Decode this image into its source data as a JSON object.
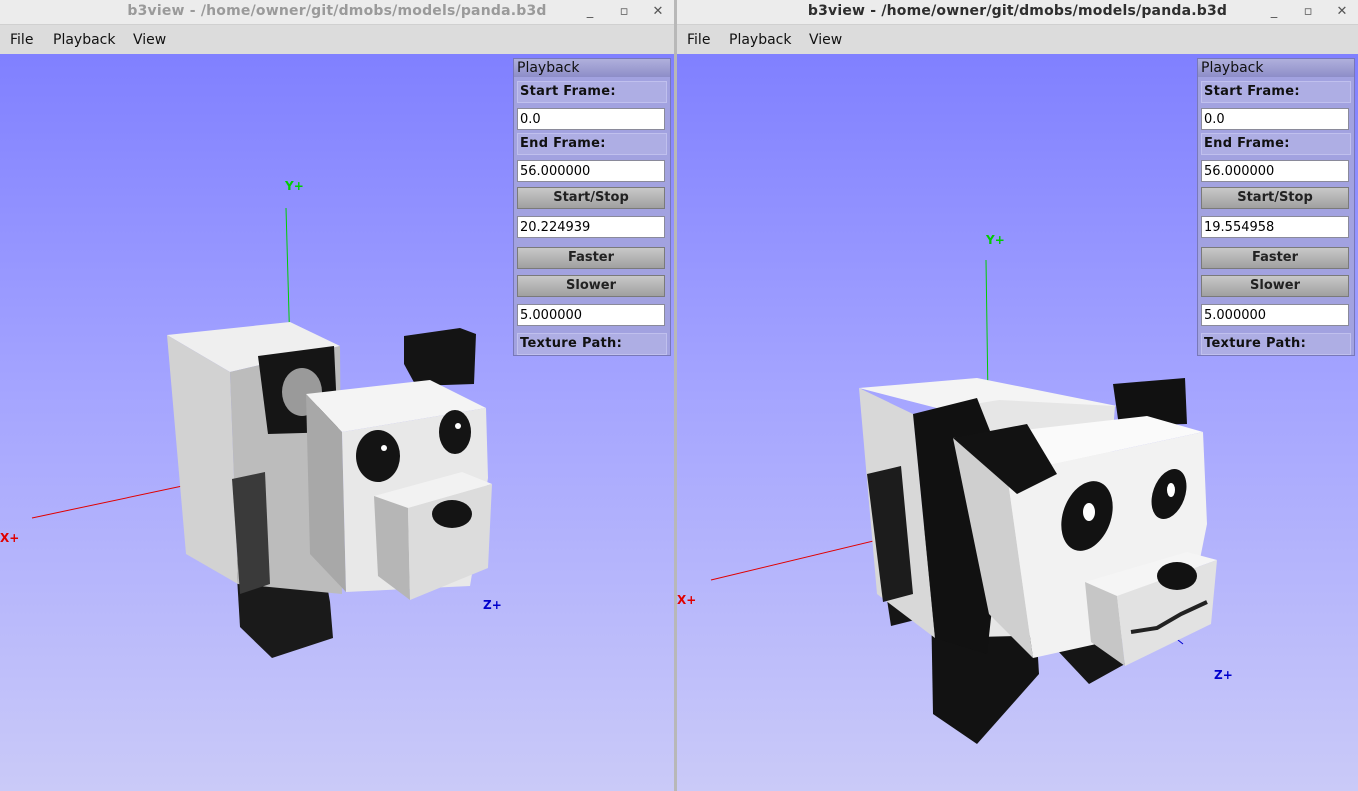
{
  "windows": [
    {
      "title": "b3view - /home/owner/git/dmobs/models/panda.b3d",
      "controls": {
        "minimize": "_",
        "maximize": "▫",
        "close": "✕"
      },
      "menu": [
        "File",
        "Playback",
        "View"
      ],
      "panel": {
        "title": "Playback",
        "start_frame_label": "Start Frame:",
        "start_frame_value": "0.0",
        "end_frame_label": "End Frame:",
        "end_frame_value": "56.000000",
        "start_stop_label": "Start/Stop",
        "current_frame_value": "20.224939",
        "faster_label": "Faster",
        "slower_label": "Slower",
        "speed_value": "5.000000",
        "texture_path_label": "Texture Path:"
      },
      "axes": {
        "x": "X+",
        "y": "Y+",
        "z": "Z+"
      }
    },
    {
      "title": "b3view - /home/owner/git/dmobs/models/panda.b3d",
      "controls": {
        "minimize": "_",
        "maximize": "▫",
        "close": "✕"
      },
      "menu": [
        "File",
        "Playback",
        "View"
      ],
      "panel": {
        "title": "Playback",
        "start_frame_label": "Start Frame:",
        "start_frame_value": "0.0",
        "end_frame_label": "End Frame:",
        "end_frame_value": "56.000000",
        "start_stop_label": "Start/Stop",
        "current_frame_value": "19.554958",
        "faster_label": "Faster",
        "slower_label": "Slower",
        "speed_value": "5.000000",
        "texture_path_label": "Texture Path:"
      },
      "axes": {
        "x": "X+",
        "y": "Y+",
        "z": "Z+"
      }
    }
  ],
  "colors": {
    "viewport_top": "#8080ff",
    "viewport_bottom": "#cacaf8",
    "axis_x": "#e00000",
    "axis_y": "#00cc00",
    "axis_z": "#0000cc"
  }
}
